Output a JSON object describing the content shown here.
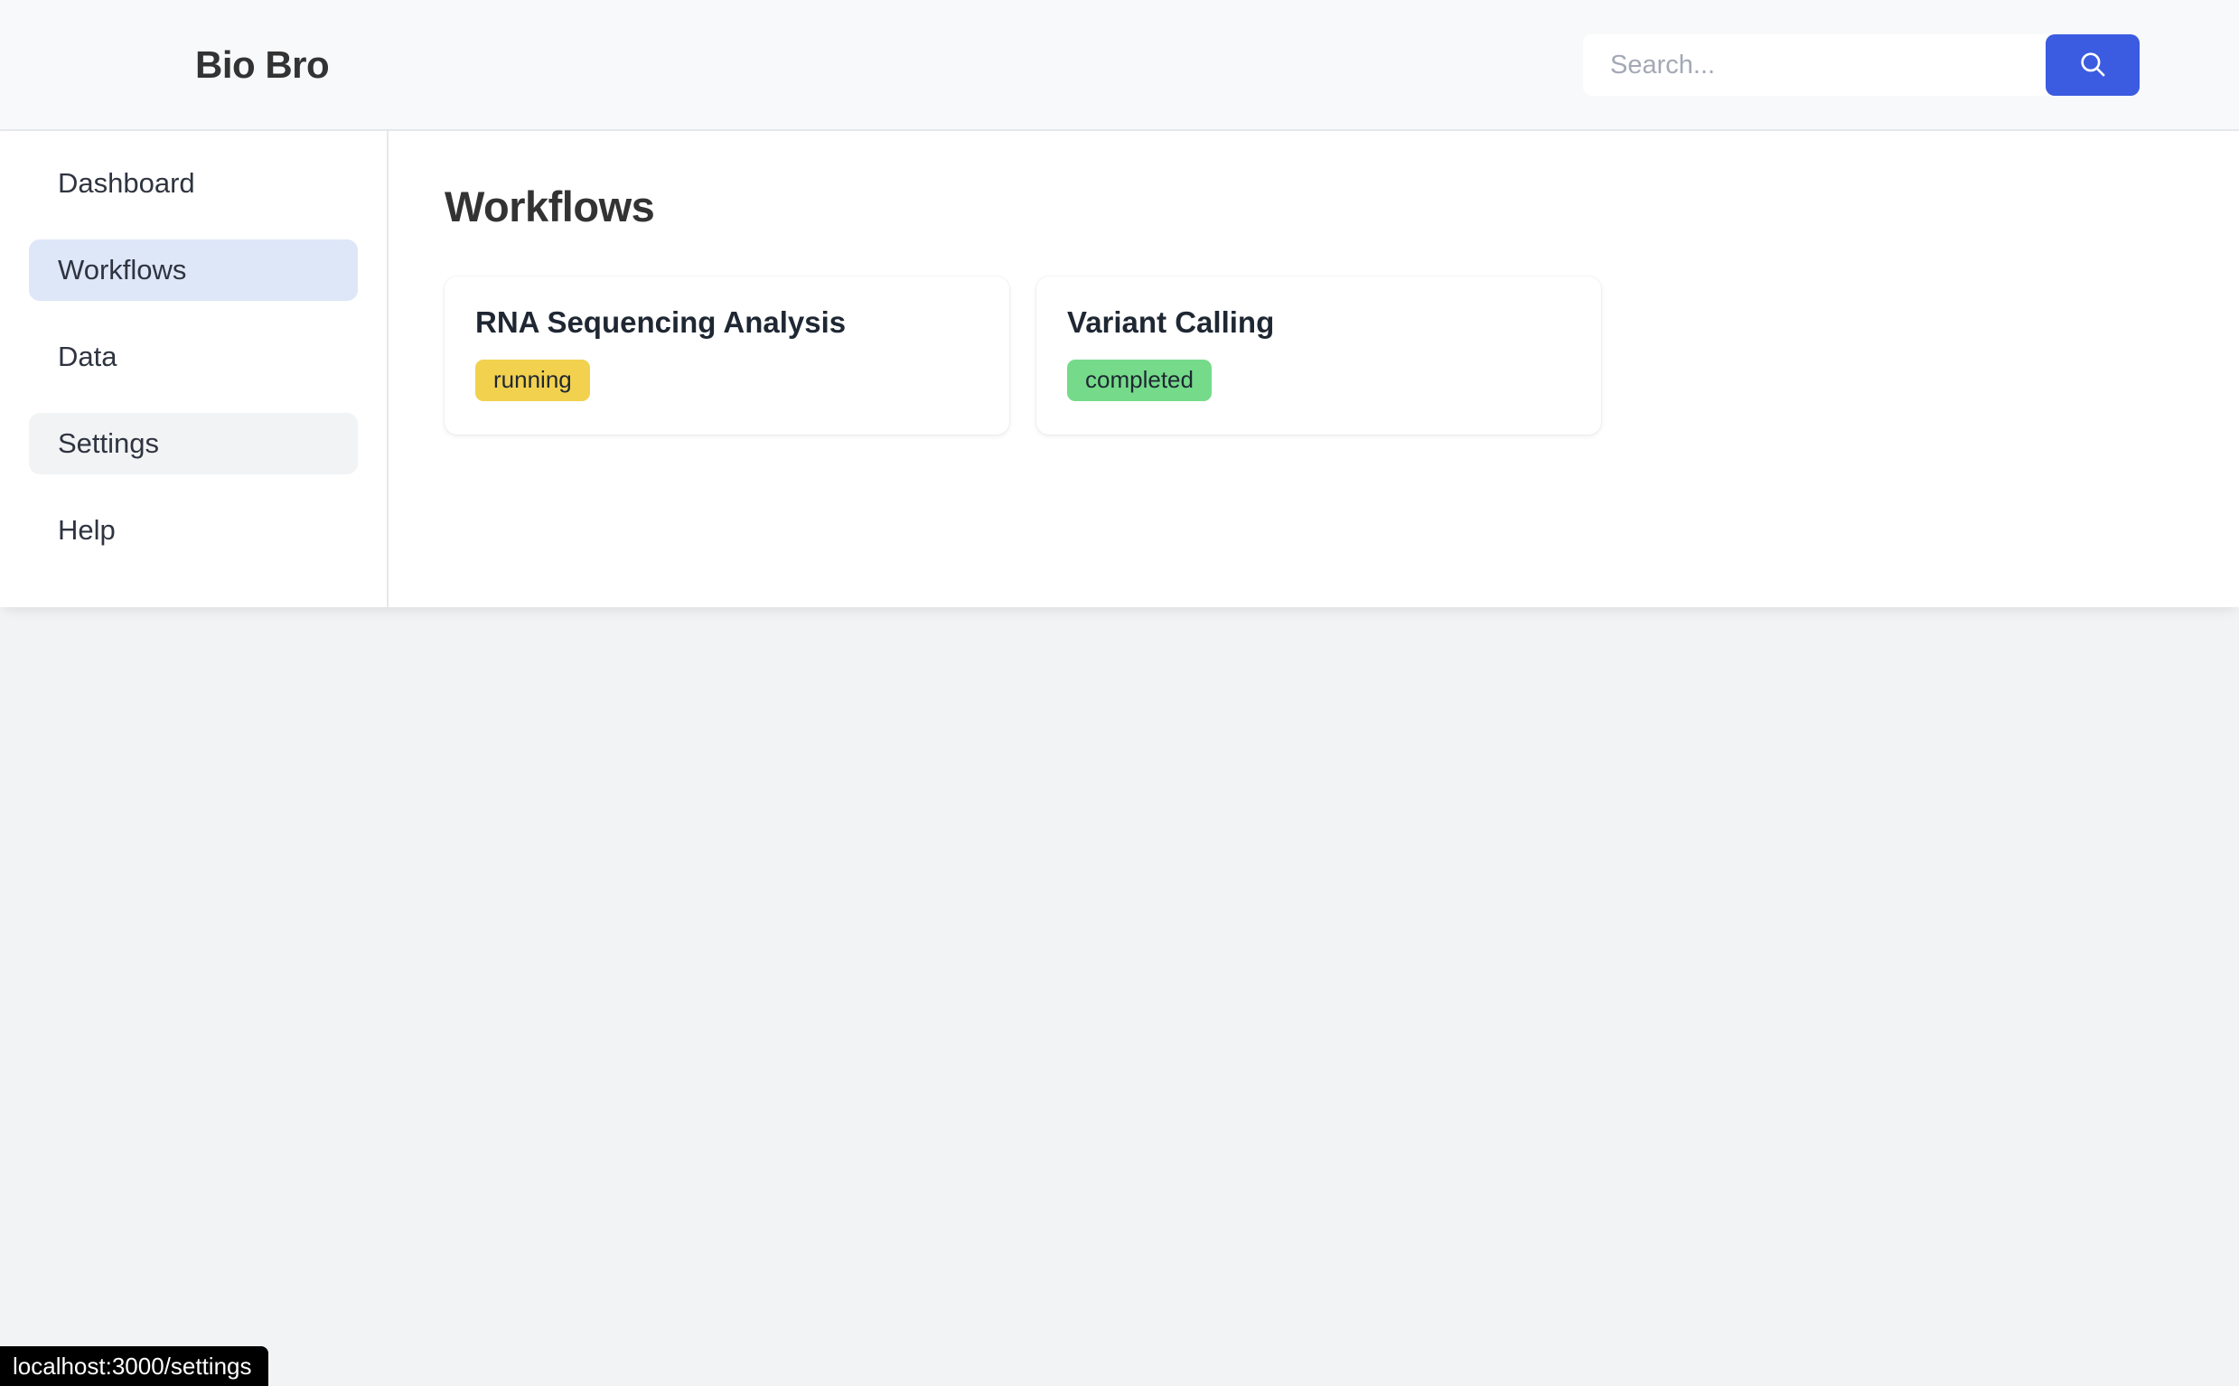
{
  "header": {
    "brand": "Bio Bro",
    "search": {
      "placeholder": "Search...",
      "value": "",
      "button_icon": "search-icon"
    }
  },
  "sidebar": {
    "items": [
      {
        "label": "Dashboard",
        "state": "default"
      },
      {
        "label": "Workflows",
        "state": "active"
      },
      {
        "label": "Data",
        "state": "default"
      },
      {
        "label": "Settings",
        "state": "hover"
      },
      {
        "label": "Help",
        "state": "default"
      }
    ]
  },
  "main": {
    "title": "Workflows",
    "cards": [
      {
        "title": "RNA Sequencing Analysis",
        "status": "running",
        "status_color": "#F2D14F"
      },
      {
        "title": "Variant Calling",
        "status": "completed",
        "status_color": "#75DB8A"
      }
    ]
  },
  "status_bar": {
    "url": "localhost:3000/settings"
  },
  "colors": {
    "accent": "#3B5BE0",
    "header_bg": "#F8F9FB",
    "page_bg": "#F2F3F5",
    "nav_active_bg": "#DEE7F8",
    "nav_hover_bg": "#F1F3F5",
    "badge_running": "#F2D14F",
    "badge_completed": "#75DB8A"
  }
}
